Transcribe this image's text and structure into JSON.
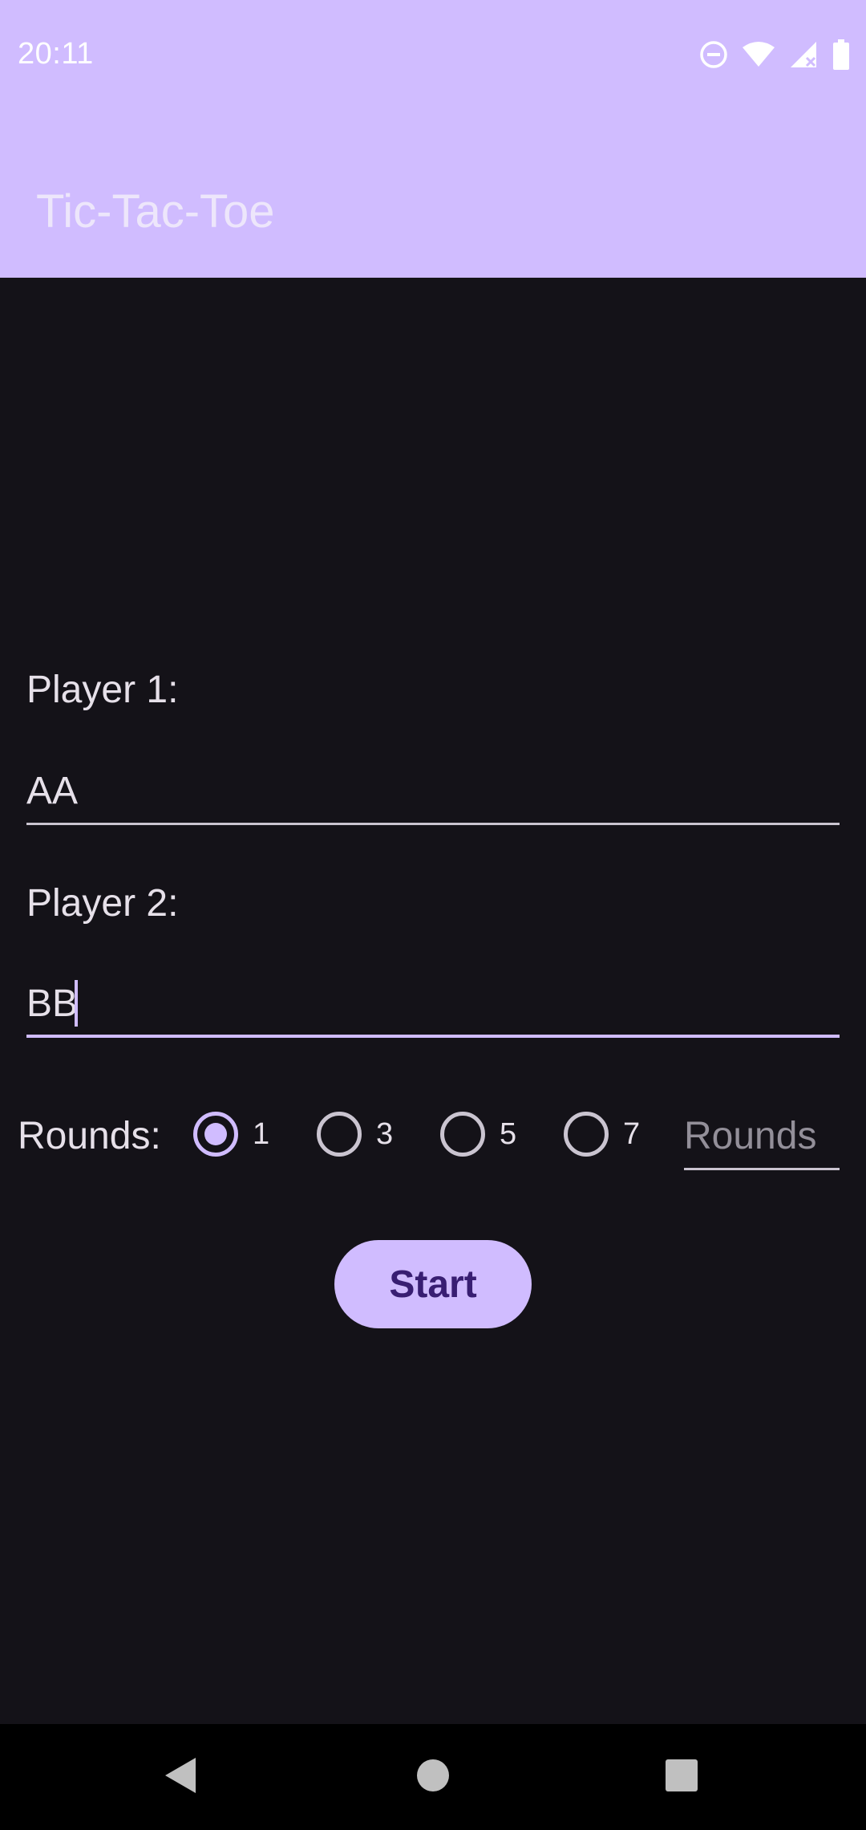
{
  "status_bar": {
    "time": "20:11",
    "icons": [
      "do-not-disturb-icon",
      "wifi-icon",
      "signal-icon",
      "battery-icon"
    ]
  },
  "app_bar": {
    "title": "Tic-Tac-Toe"
  },
  "form": {
    "player1_label": "Player 1:",
    "player1_value": "AA",
    "player2_label": "Player 2:",
    "player2_value": "BB",
    "rounds_label": "Rounds:",
    "round_options": [
      {
        "label": "1",
        "checked": true
      },
      {
        "label": "3",
        "checked": false
      },
      {
        "label": "5",
        "checked": false
      },
      {
        "label": "7",
        "checked": false
      }
    ],
    "rounds_placeholder": "Rounds",
    "start_label": "Start"
  },
  "nav_bar": {
    "icons": [
      "back-icon",
      "home-icon",
      "recents-icon"
    ]
  },
  "colors": {
    "primary": "#d0bcff",
    "background": "#141218",
    "on_primary": "#381e72",
    "outline": "#cac4d0"
  }
}
